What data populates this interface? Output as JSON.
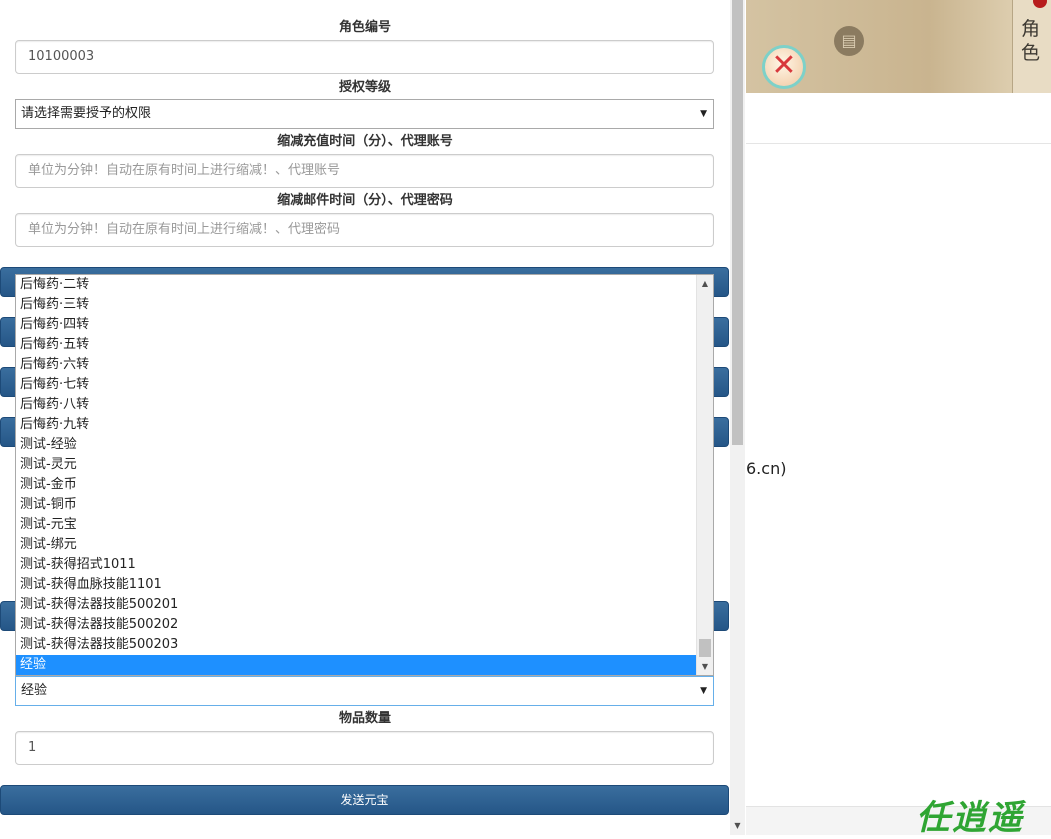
{
  "form": {
    "role_id_label": "角色编号",
    "role_id_value": "10100003",
    "auth_level_label": "授权等级",
    "auth_level_value": "请选择需要授予的权限",
    "recharge_label": "缩减充值时间（分）、代理账号",
    "recharge_placeholder": "单位为分钟！自动在原有时间上进行缩减！、代理账号",
    "mail_label": "缩减邮件时间（分）、代理密码",
    "mail_placeholder": "单位为分钟！自动在原有时间上进行缩减！、代理密码",
    "item_select_value": "经验",
    "quantity_label": "物品数量",
    "quantity_value": "1",
    "send_button_label": "发送元宝"
  },
  "item_list": {
    "options": [
      "后悔药·二转",
      "后悔药·三转",
      "后悔药·四转",
      "后悔药·五转",
      "后悔药·六转",
      "后悔药·七转",
      "后悔药·八转",
      "后悔药·九转",
      "测试-经验",
      "测试-灵元",
      "测试-金币",
      "测试-铜币",
      "测试-元宝",
      "测试-绑元",
      "测试-获得招式1011",
      "测试-获得血脉技能1101",
      "测试-获得法器技能500201",
      "测试-获得法器技能500202",
      "测试-获得法器技能500203",
      "经验"
    ],
    "selected": "经验"
  },
  "right": {
    "game_side_text": "角色",
    "partial_url_text": "6.cn)",
    "watermark": "任逍遥"
  },
  "colors": {
    "button_primary": "#2b5f92",
    "selected_option": "#1e90ff",
    "watermark": "#2fa533"
  }
}
